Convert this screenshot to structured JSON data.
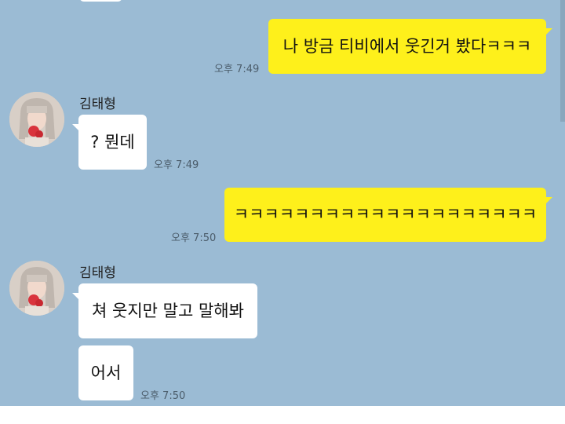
{
  "chat": {
    "messages": [
      {
        "sender": "me",
        "text": "나 방금 티비에서 웃긴거 봤다ㅋㅋㅋ",
        "time": "오후 7:49"
      },
      {
        "sender": "김태형",
        "text": "? 뭔데",
        "time": "오후 7:49"
      },
      {
        "sender": "me",
        "text": "ㅋㅋㅋㅋㅋㅋㅋㅋㅋㅋㅋㅋㅋㅋㅋㅋㅋㅋㅋㅋ",
        "time": "오후 7:50"
      },
      {
        "sender": "김태형",
        "text": "쳐 웃지만 말고 말해봐",
        "time": ""
      },
      {
        "sender": "김태형",
        "text": "어서",
        "time": "오후 7:50"
      }
    ],
    "contact_name": "김태형"
  },
  "colors": {
    "background": "#9bbbd4",
    "my_bubble": "#fef01b",
    "their_bubble": "#ffffff"
  },
  "icons": {
    "avatar": "profile-photo"
  }
}
